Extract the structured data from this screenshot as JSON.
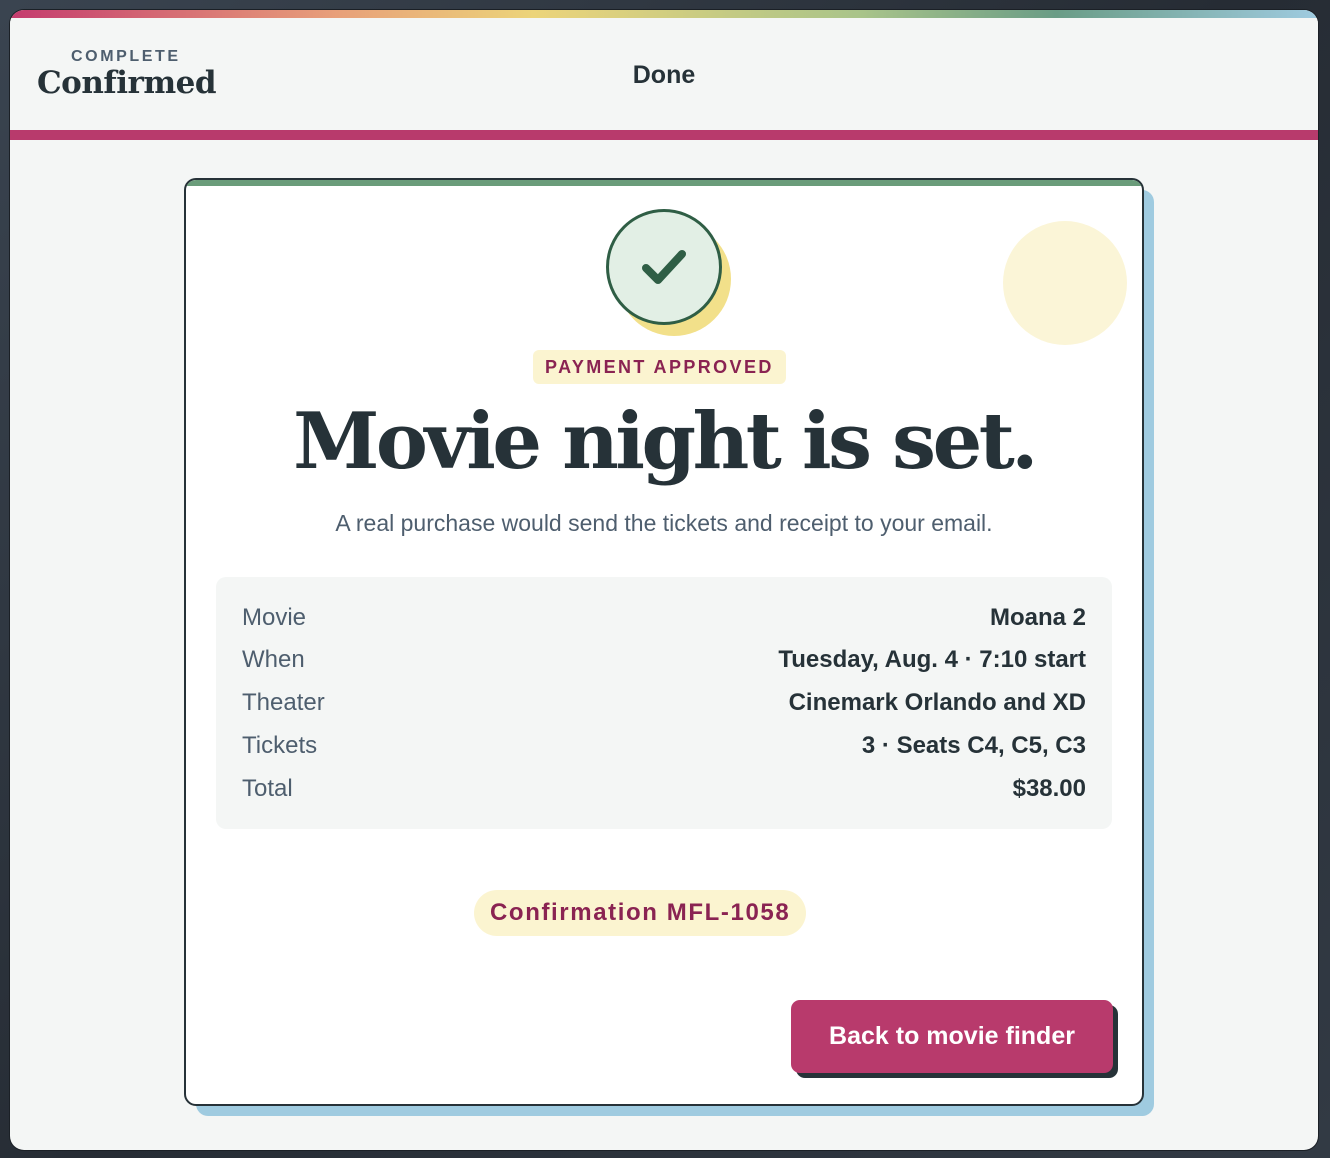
{
  "header": {
    "kicker": "COMPLETE",
    "title": "Confirmed",
    "center_label": "Done"
  },
  "card": {
    "badge": "PAYMENT APPROVED",
    "headline": "Movie night is set.",
    "subtext": "A real purchase would send the tickets and receipt to your email.",
    "summary": [
      {
        "label": "Movie",
        "value": "Moana 2"
      },
      {
        "label": "When",
        "value": "Tuesday, Aug. 4 · 7:10 start"
      },
      {
        "label": "Theater",
        "value": "Cinemark Orlando and XD"
      },
      {
        "label": "Tickets",
        "value": "3 · Seats C4, C5, C3"
      },
      {
        "label": "Total",
        "value": "$38.00"
      }
    ],
    "confirmation": "Confirmation MFL-1058",
    "button_label": "Back to movie finder"
  },
  "icons": {
    "status": "check-icon"
  },
  "colors": {
    "accent": "#b83a6c",
    "success": "#2f5e45",
    "highlight": "#fbf4d0",
    "ink": "#263238"
  }
}
